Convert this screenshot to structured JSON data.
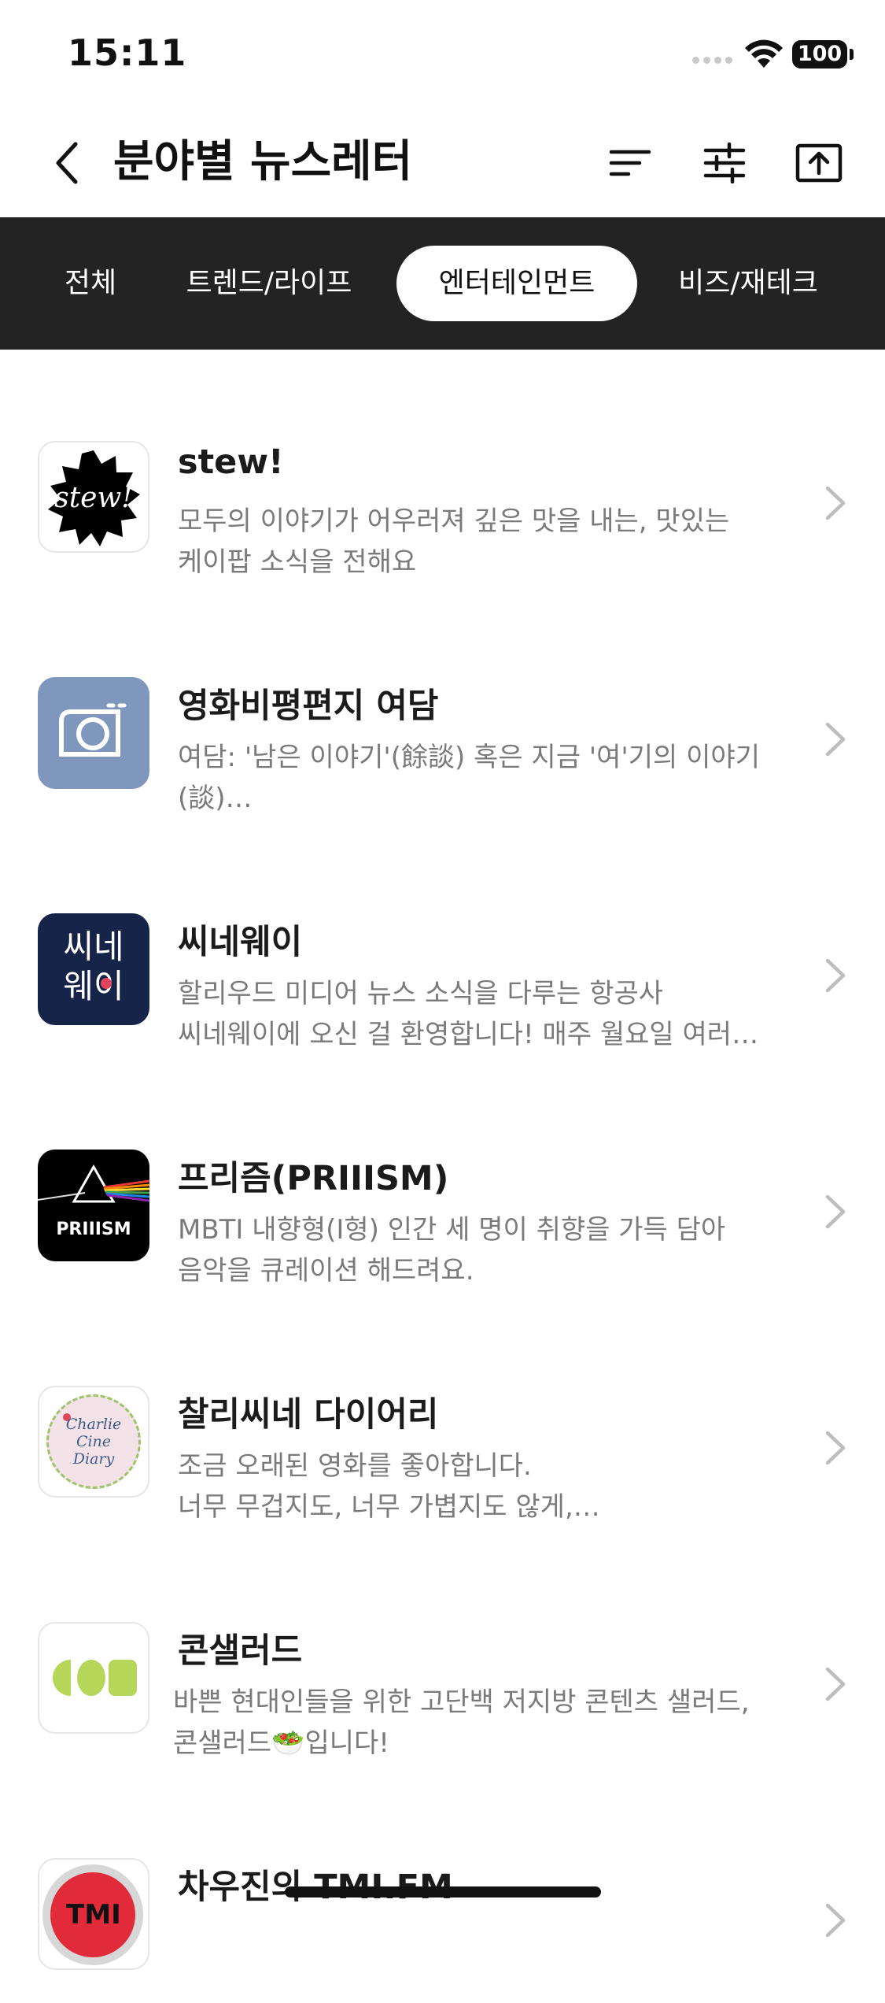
{
  "status_bar": {
    "time": "15:11",
    "battery": "100"
  },
  "header": {
    "title": "분야별 뉴스레터"
  },
  "icons": {
    "back": "chevron-left-icon",
    "sort": "sort-lines-icon",
    "filter": "sliders-icon",
    "share": "upload-box-icon",
    "row_arrow": "chevron-right-icon"
  },
  "tabs": [
    {
      "label": "전체",
      "active": false
    },
    {
      "label": "트렌드/라이프",
      "active": false
    },
    {
      "label": "엔터테인먼트",
      "active": true
    },
    {
      "label": "비즈/재테크",
      "active": false
    }
  ],
  "newsletters": [
    {
      "title": "stew!",
      "desc_lines": [
        "모두의 이야기가 어우러져 깊은 맛을 내는, 맛있는",
        "케이팝 소식을 전해요"
      ],
      "logo_text": "stew!"
    },
    {
      "title": "영화비평편지 여담",
      "desc_lines": [
        "여담: '남은 이야기'(餘談) 혹은 지금 '여'기의 이야기",
        "(談)…"
      ]
    },
    {
      "title": "씨네웨이",
      "desc_lines": [
        "할리우드 미디어 뉴스 소식을 다루는 항공사",
        "씨네웨이에 오신 걸 환영합니다! 매주 월요일 여러…"
      ],
      "logo_text": [
        "씨네",
        "웨이"
      ]
    },
    {
      "title": "프리즘(PRIIISM)",
      "desc_lines": [
        "MBTI 내향형(I형) 인간 세 명이 취향을 가득 담아",
        "음악을 큐레이션 해드려요."
      ],
      "logo_text": "PRIIISM"
    },
    {
      "title": "찰리씨네 다이어리",
      "desc_lines": [
        "조금 오래된 영화를 좋아합니다.",
        "너무 무겁지도, 너무 가볍지도 않게,…"
      ],
      "logo_text": [
        "Charlie",
        "Cine",
        "Diary"
      ]
    },
    {
      "title": "콘샐러드",
      "desc_lines": [
        "바쁜 현대인들을 위한 고단백 저지방 콘텐츠 샐러드,",
        "콘샐러드🥗입니다!"
      ]
    },
    {
      "title": "차우진의 TMI.FM",
      "desc_lines": [
        "",
        ""
      ],
      "logo_text": "TMI"
    }
  ],
  "colors": {
    "tab_bar": "#232323",
    "title_text": "#1b1b1b",
    "desc_text": "#7a7a7a",
    "yeodam_logo": "#7f97bd",
    "cineway_logo": "#17244a",
    "consalad_green": "#b6d65a"
  }
}
